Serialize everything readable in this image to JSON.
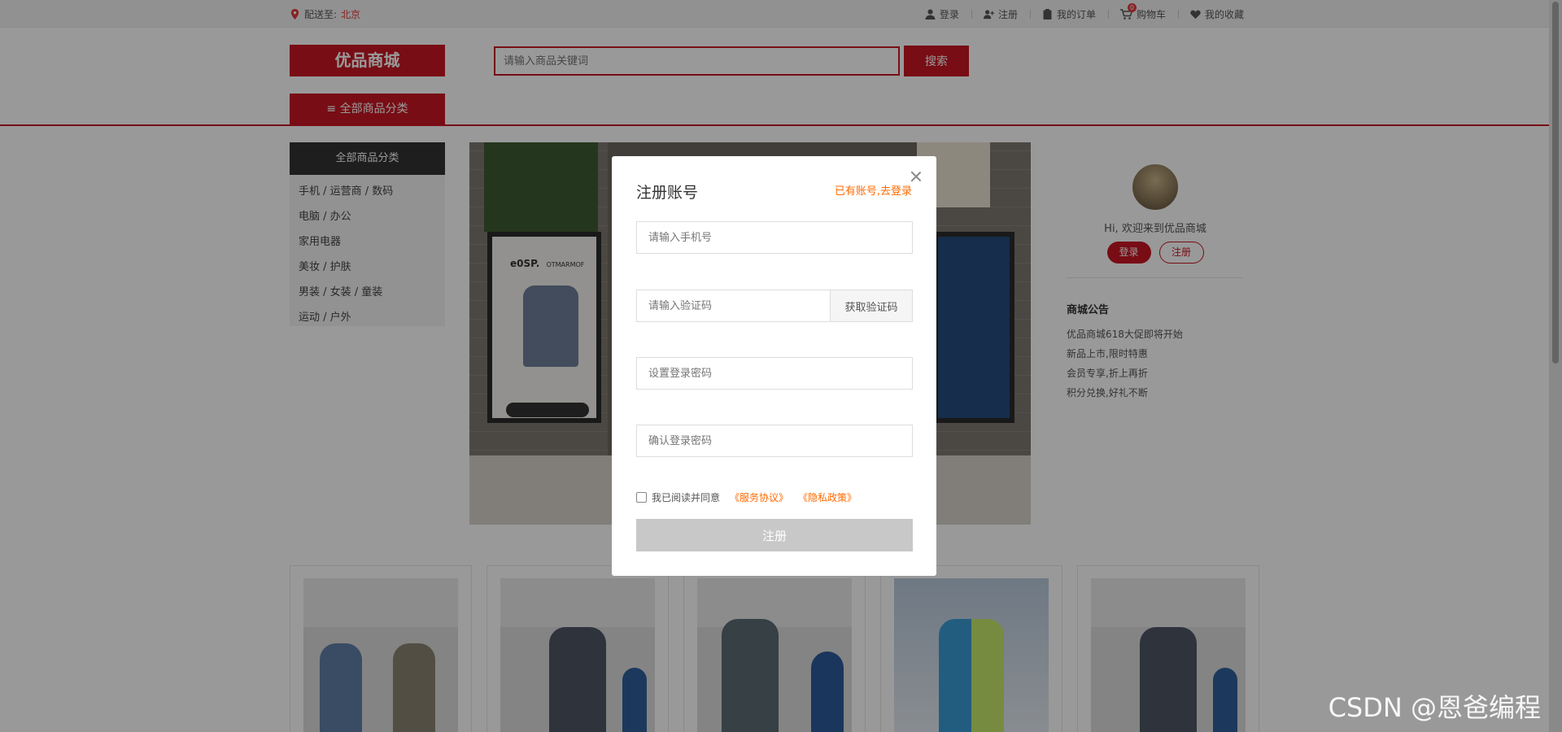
{
  "topbar": {
    "deliver_label": "配送至:",
    "city": "北京",
    "links": [
      {
        "label": "登录",
        "icon": "user-icon"
      },
      {
        "label": "注册",
        "icon": "user-add-icon"
      },
      {
        "label": "我的订单",
        "icon": "clipboard-icon"
      },
      {
        "label": "购物车",
        "icon": "cart-icon",
        "badge": "0"
      },
      {
        "label": "我的收藏",
        "icon": "heart-icon"
      }
    ]
  },
  "header": {
    "logo": "优品商城",
    "search_placeholder": "请输入商品关键词",
    "search_button": "搜索",
    "all_category_tab": "≡ 全部商品分类"
  },
  "category_sidebar": {
    "title": "全部商品分类",
    "items": [
      "手机  /  运营商  /  数码",
      "电脑  /  办公",
      "家用电器",
      "美妆  /  护肤",
      "男装  /  女装  /  童装",
      "运动  /  户外"
    ]
  },
  "banner": {
    "frame_label": "e0SP.",
    "frame_label2": "OTMARMOF"
  },
  "user_panel": {
    "welcome": "Hi, 欢迎来到优品商城",
    "login": "登录",
    "register": "注册"
  },
  "notice": {
    "title": "商城公告",
    "items": [
      "优品商城618大促即将开始",
      "新品上市,限时特惠",
      "会员专享,折上再折",
      "积分兑换,好礼不断"
    ]
  },
  "modal": {
    "title": "注册账号",
    "login_link": "已有账号,去登录",
    "phone_placeholder": "请输入手机号",
    "code_placeholder": "请输入验证码",
    "get_code": "获取验证码",
    "password_placeholder": "设置登录密码",
    "confirm_placeholder": "确认登录密码",
    "agree_text": "我已阅读并同意",
    "service_link": "《服务协议》",
    "privacy_link": "《隐私政策》",
    "submit": "注册"
  },
  "watermark": "CSDN @恩爸编程",
  "colors": {
    "brand": "#c81623",
    "accent": "#ff6a00",
    "overlay": "rgba(0,0,0,0.4)"
  }
}
